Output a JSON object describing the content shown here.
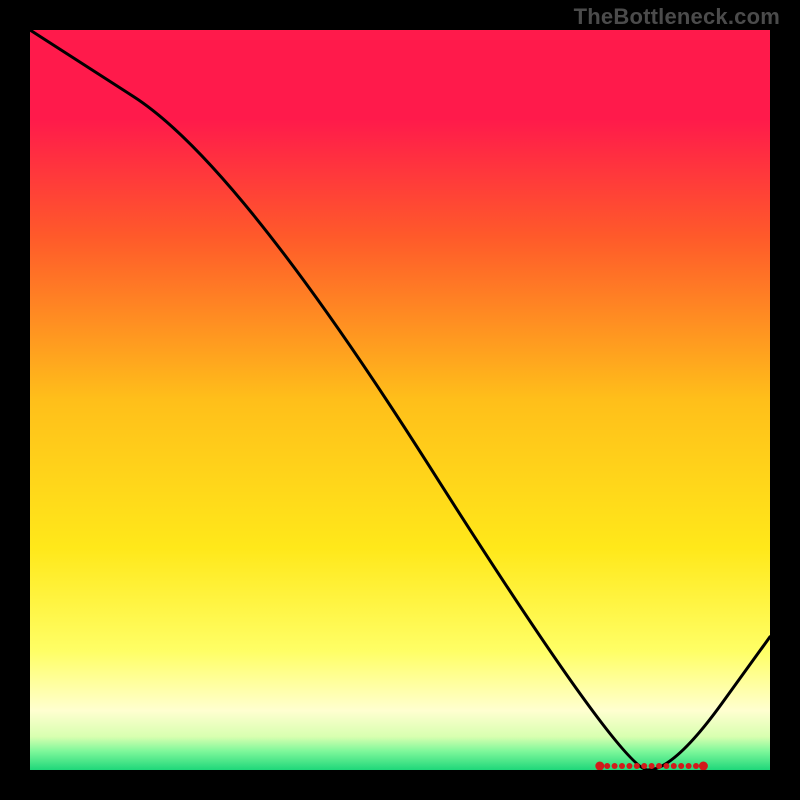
{
  "watermark": "TheBottleneck.com",
  "chart_data": {
    "type": "line",
    "title": "",
    "xlabel": "",
    "ylabel": "",
    "xlim": [
      0,
      100
    ],
    "ylim": [
      0,
      100
    ],
    "x": [
      0,
      28,
      80,
      87,
      100
    ],
    "values": [
      100,
      82,
      0,
      0,
      18
    ],
    "annotation": {
      "text": "",
      "x_range": [
        77,
        91
      ],
      "y": 0
    },
    "background_gradient": {
      "stops": [
        {
          "pos": 0.0,
          "color": "#ff1a4b"
        },
        {
          "pos": 0.12,
          "color": "#ff1a4b"
        },
        {
          "pos": 0.28,
          "color": "#ff5a2a"
        },
        {
          "pos": 0.5,
          "color": "#ffbf1a"
        },
        {
          "pos": 0.7,
          "color": "#ffe81a"
        },
        {
          "pos": 0.84,
          "color": "#ffff66"
        },
        {
          "pos": 0.92,
          "color": "#ffffd0"
        },
        {
          "pos": 0.955,
          "color": "#d8ffb0"
        },
        {
          "pos": 0.975,
          "color": "#7cf79a"
        },
        {
          "pos": 1.0,
          "color": "#1fd77a"
        }
      ]
    }
  }
}
